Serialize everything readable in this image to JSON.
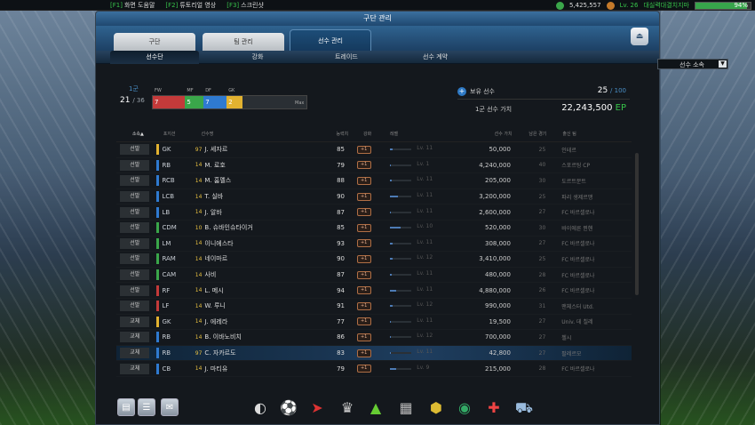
{
  "topbar": {
    "f1_key": "[F1]",
    "f1_label": "화면 도움말",
    "f2_key": "[F2]",
    "f2_label": "튜토리얼 영상",
    "f3_key": "[F3]",
    "f3_label": "스크린샷",
    "coins": "5,425,557",
    "level": "Lv. 26",
    "club": "대실력대결치지마",
    "exp_percent": "94%",
    "exp_fraction": 0.94
  },
  "panel_title": "구단 관리",
  "main_tabs": [
    {
      "label": "구단"
    },
    {
      "label": "팀 관리"
    },
    {
      "label": "선수 관리"
    }
  ],
  "sub_tabs": [
    {
      "label": "선수단"
    },
    {
      "label": "강화"
    },
    {
      "label": "트레이드"
    },
    {
      "label": "선수 계약"
    }
  ],
  "filter_dropdown": "선수 소속",
  "squad": {
    "label": "1군",
    "count": "21",
    "max": "/ 36",
    "positions": [
      {
        "pos": "FW",
        "count": "7",
        "color": "#c43a3a"
      },
      {
        "pos": "MF",
        "count": "5",
        "color": "#3aa64a"
      },
      {
        "pos": "DF",
        "count": "7",
        "color": "#2f7ad0"
      },
      {
        "pos": "GK",
        "count": "2",
        "color": "#e2b230"
      }
    ],
    "max_label": "Max"
  },
  "owned": {
    "label": "보유 선수",
    "value": "25",
    "max": "/ 100"
  },
  "squad_value": {
    "label": "1군 선수 가치",
    "value": "22,243,500",
    "unit": "EP"
  },
  "table": {
    "headers": [
      "소속▲",
      "포지션",
      "선수명",
      "능력치",
      "강화",
      "레벨",
      "선수 가치",
      "남은 경기",
      "출신 팀"
    ],
    "rows": [
      {
        "status": "선발",
        "pos": "GK",
        "line": "gk",
        "no": "97",
        "name": "J. 세자르",
        "abil": "85",
        "enh": "+1",
        "lvl_text": "Lv. 11",
        "lvl_fill": 0.1,
        "value": "50,000",
        "games": "25",
        "club": "인테르"
      },
      {
        "status": "선발",
        "pos": "RB",
        "line": "df",
        "no": "14",
        "name": "M. 로호",
        "abil": "79",
        "enh": "+1",
        "lvl_text": "Lv. 1",
        "lvl_fill": 0.05,
        "value": "4,240,000",
        "games": "40",
        "club": "스포르팅 CP"
      },
      {
        "status": "선발",
        "pos": "RCB",
        "line": "df",
        "no": "14",
        "name": "M. 훔멜스",
        "abil": "88",
        "enh": "+1",
        "lvl_text": "Lv. 11",
        "lvl_fill": 0.08,
        "value": "205,000",
        "games": "30",
        "club": "도르트문트"
      },
      {
        "status": "선발",
        "pos": "LCB",
        "line": "df",
        "no": "14",
        "name": "T. 실바",
        "abil": "90",
        "enh": "+1",
        "lvl_text": "Lv. 11",
        "lvl_fill": 0.35,
        "value": "3,200,000",
        "games": "25",
        "club": "파리 생제르맹"
      },
      {
        "status": "선발",
        "pos": "LB",
        "line": "df",
        "no": "14",
        "name": "J. 알바",
        "abil": "87",
        "enh": "+1",
        "lvl_text": "Lv. 11",
        "lvl_fill": 0.05,
        "value": "2,600,000",
        "games": "27",
        "club": "FC 바르셀로나"
      },
      {
        "status": "선발",
        "pos": "CDM",
        "line": "mf",
        "no": "10",
        "name": "B. 슈바인슈타이거",
        "abil": "85",
        "enh": "+1",
        "lvl_text": "Lv. 10",
        "lvl_fill": 0.5,
        "value": "520,000",
        "games": "30",
        "club": "바이에른 뮌헨"
      },
      {
        "status": "선발",
        "pos": "LM",
        "line": "mf",
        "no": "14",
        "name": "이니에스타",
        "abil": "93",
        "enh": "+1",
        "lvl_text": "Lv. 11",
        "lvl_fill": 0.12,
        "value": "308,000",
        "games": "27",
        "club": "FC 바르셀로나"
      },
      {
        "status": "선발",
        "pos": "RAM",
        "line": "mf",
        "no": "14",
        "name": "네이마르",
        "abil": "90",
        "enh": "+1",
        "lvl_text": "Lv. 12",
        "lvl_fill": 0.1,
        "value": "3,410,000",
        "games": "25",
        "club": "FC 바르셀로나"
      },
      {
        "status": "선발",
        "pos": "CAM",
        "line": "mf",
        "no": "14",
        "name": "사비",
        "abil": "87",
        "enh": "+1",
        "lvl_text": "Lv. 11",
        "lvl_fill": 0.08,
        "value": "480,000",
        "games": "28",
        "club": "FC 바르셀로나"
      },
      {
        "status": "선발",
        "pos": "RF",
        "line": "fw",
        "no": "14",
        "name": "L. 메시",
        "abil": "94",
        "enh": "+1",
        "lvl_text": "Lv. 11",
        "lvl_fill": 0.3,
        "value": "4,880,000",
        "games": "26",
        "club": "FC 바르셀로나"
      },
      {
        "status": "선발",
        "pos": "LF",
        "line": "fw",
        "no": "14",
        "name": "W. 루니",
        "abil": "91",
        "enh": "+1",
        "lvl_text": "Lv. 12",
        "lvl_fill": 0.12,
        "value": "990,000",
        "games": "31",
        "club": "맨체스터 Utd."
      },
      {
        "status": "교체",
        "pos": "GK",
        "line": "gk",
        "no": "14",
        "name": "J. 에레라",
        "abil": "77",
        "enh": "+1",
        "lvl_text": "Lv. 11",
        "lvl_fill": 0.05,
        "value": "19,500",
        "games": "27",
        "club": "Univ. 데 칠레"
      },
      {
        "status": "교체",
        "pos": "RB",
        "line": "df",
        "no": "14",
        "name": "B. 이바노비치",
        "abil": "86",
        "enh": "+1",
        "lvl_text": "Lv. 12",
        "lvl_fill": 0.05,
        "value": "700,000",
        "games": "27",
        "club": "첼시"
      },
      {
        "status": "교체",
        "pos": "RB",
        "line": "df",
        "no": "97",
        "name": "C. 자카르도",
        "abil": "83",
        "enh": "+1",
        "lvl_text": "Lv. 11",
        "lvl_fill": 0.05,
        "value": "42,800",
        "games": "27",
        "club": "팔레르모",
        "selected": true
      },
      {
        "status": "교체",
        "pos": "CB",
        "line": "df",
        "no": "14",
        "name": "J. 마티유",
        "abil": "79",
        "enh": "+1",
        "lvl_text": "Lv. 9",
        "lvl_fill": 0.3,
        "value": "215,000",
        "games": "28",
        "club": "FC 바르셀로나"
      }
    ]
  },
  "bottom_icons": [
    "document-icon",
    "list-icon",
    "mail-icon",
    "whistle-icon",
    "ball-icon",
    "boot-icon",
    "trophy-icon",
    "cone-icon",
    "card-icon",
    "badge-icon",
    "club-icon",
    "medical-icon",
    "cart-icon"
  ]
}
